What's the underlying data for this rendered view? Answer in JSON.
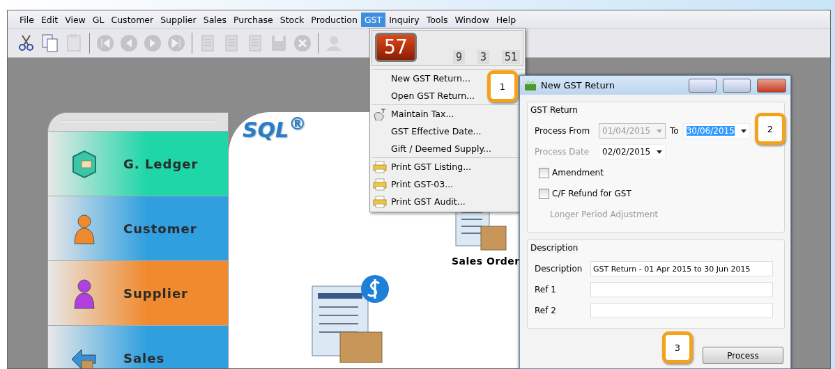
{
  "menu_bar": [
    {
      "label": "File",
      "selected": false
    },
    {
      "label": "Edit",
      "selected": false
    },
    {
      "label": "View",
      "selected": false
    },
    {
      "label": "GL",
      "selected": false
    },
    {
      "label": "Customer",
      "selected": false
    },
    {
      "label": "Supplier",
      "selected": false
    },
    {
      "label": "Sales",
      "selected": false
    },
    {
      "label": "Purchase",
      "selected": false
    },
    {
      "label": "Stock",
      "selected": false
    },
    {
      "label": "Production",
      "selected": false
    },
    {
      "label": "GST",
      "selected": true
    },
    {
      "label": "Inquiry",
      "selected": false
    },
    {
      "label": "Tools",
      "selected": false
    },
    {
      "label": "Window",
      "selected": false
    },
    {
      "label": "Help",
      "selected": false
    }
  ],
  "toolbar": [
    {
      "kind": "cut",
      "disabled": false
    },
    {
      "kind": "copy",
      "disabled": false
    },
    {
      "kind": "paste",
      "disabled": true
    },
    {
      "kind": "separator"
    },
    {
      "kind": "first",
      "disabled": true
    },
    {
      "kind": "previous",
      "disabled": true
    },
    {
      "kind": "next",
      "disabled": true
    },
    {
      "kind": "last",
      "disabled": true
    },
    {
      "kind": "separator"
    },
    {
      "kind": "document",
      "disabled": true
    },
    {
      "kind": "document",
      "disabled": true
    },
    {
      "kind": "document",
      "disabled": true
    },
    {
      "kind": "save",
      "disabled": true
    },
    {
      "kind": "cancel",
      "disabled": true
    },
    {
      "kind": "separator"
    },
    {
      "kind": "user",
      "disabled": true
    }
  ],
  "gst_menu": {
    "clock": {
      "main": "57",
      "parts": [
        "9",
        "3",
        "51"
      ]
    },
    "groups": [
      [
        {
          "label": "New GST Return...",
          "kind": "plain"
        },
        {
          "label": "Open GST Return...",
          "kind": "plain"
        }
      ],
      [
        {
          "label": "Maintain Tax...",
          "kind": "tax"
        },
        {
          "label": "GST Effective Date...",
          "kind": "plain"
        },
        {
          "label": "Gift / Deemed Supply...",
          "kind": "plain"
        }
      ],
      [
        {
          "label": "Print GST Listing...",
          "kind": "printer"
        },
        {
          "label": "Print GST-03...",
          "kind": "printer"
        },
        {
          "label": "Print GST Audit...",
          "kind": "printer"
        }
      ]
    ]
  },
  "sidebar": {
    "items": [
      {
        "label": "G. Ledger",
        "kind": "ledger",
        "color": "#1fd6a8"
      },
      {
        "label": "Customer",
        "kind": "person",
        "color": "#2f9fe0"
      },
      {
        "label": "Supplier",
        "kind": "person",
        "color": "#f08a2e"
      },
      {
        "label": "Sales",
        "kind": "sales",
        "color": "#2f9fe0"
      }
    ]
  },
  "canvas": {
    "logo": "SQL$^{®}$",
    "items": [
      {
        "label": "Sales Order"
      }
    ]
  },
  "dialog": {
    "title": "New GST Return",
    "gst_return": {
      "title": "GST Return",
      "from_label": "Process From",
      "from_value": "01/04/2015",
      "from_disabled": true,
      "to_label": "To",
      "to_value": "30/06/2015",
      "to_selected": true,
      "date_label": "Process Date",
      "date_value": "02/02/2015",
      "date_disabled": true,
      "checks": [
        {
          "label": "Amendment",
          "checked": false
        },
        {
          "label": "C/F Refund for GST",
          "checked": false
        }
      ],
      "note": "Longer Period Adjustment",
      "note_disabled": true
    },
    "description": {
      "title": "Description",
      "fields": [
        {
          "label": "Description",
          "value": "GST Return - 01 Apr 2015 to 30 Jun 2015"
        },
        {
          "label": "Ref 1"
        },
        {
          "label": "Ref 2"
        }
      ]
    },
    "button": "Process"
  },
  "callouts": [
    "1",
    "2",
    "3"
  ]
}
